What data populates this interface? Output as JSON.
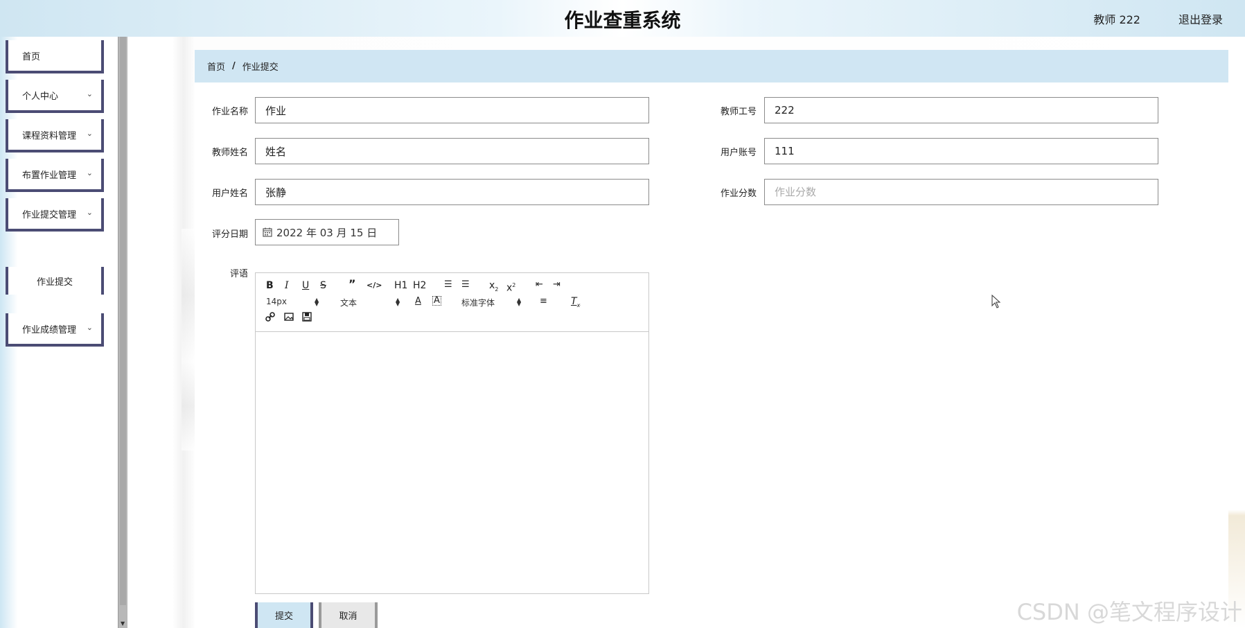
{
  "header": {
    "title": "作业查重系统",
    "user": "教师 222",
    "logout": "退出登录"
  },
  "sidebar": {
    "items": [
      {
        "label": "首页"
      },
      {
        "label": "个人中心"
      },
      {
        "label": "课程资料管理"
      },
      {
        "label": "布置作业管理"
      },
      {
        "label": "作业提交管理"
      },
      {
        "label": "作业提交"
      },
      {
        "label": "作业成绩管理"
      }
    ]
  },
  "breadcrumb": {
    "home": "首页",
    "separator": "/",
    "current": "作业提交"
  },
  "form": {
    "homework_name": {
      "label": "作业名称",
      "value": "作业"
    },
    "teacher_id": {
      "label": "教师工号",
      "value": "222"
    },
    "teacher_name": {
      "label": "教师姓名",
      "value": "姓名"
    },
    "user_account": {
      "label": "用户账号",
      "value": "111"
    },
    "user_name": {
      "label": "用户姓名",
      "value": "张静"
    },
    "score": {
      "label": "作业分数",
      "value": "",
      "placeholder": "作业分数"
    },
    "score_date": {
      "label": "评分日期",
      "value": "2022 年 03 月 15 日"
    },
    "comment": {
      "label": "评语"
    }
  },
  "editor": {
    "font_size": "14px",
    "block_type": "文本",
    "font_family": "标准字体",
    "h1": "H1",
    "h2": "H2"
  },
  "buttons": {
    "submit": "提交",
    "cancel": "取消"
  },
  "watermark": "CSDN @笔文程序设计",
  "colors": {
    "accent": "#4b4c74",
    "breadcrumb_bg": "#d0e6f3",
    "submit_bg": "#cfe6f3"
  }
}
